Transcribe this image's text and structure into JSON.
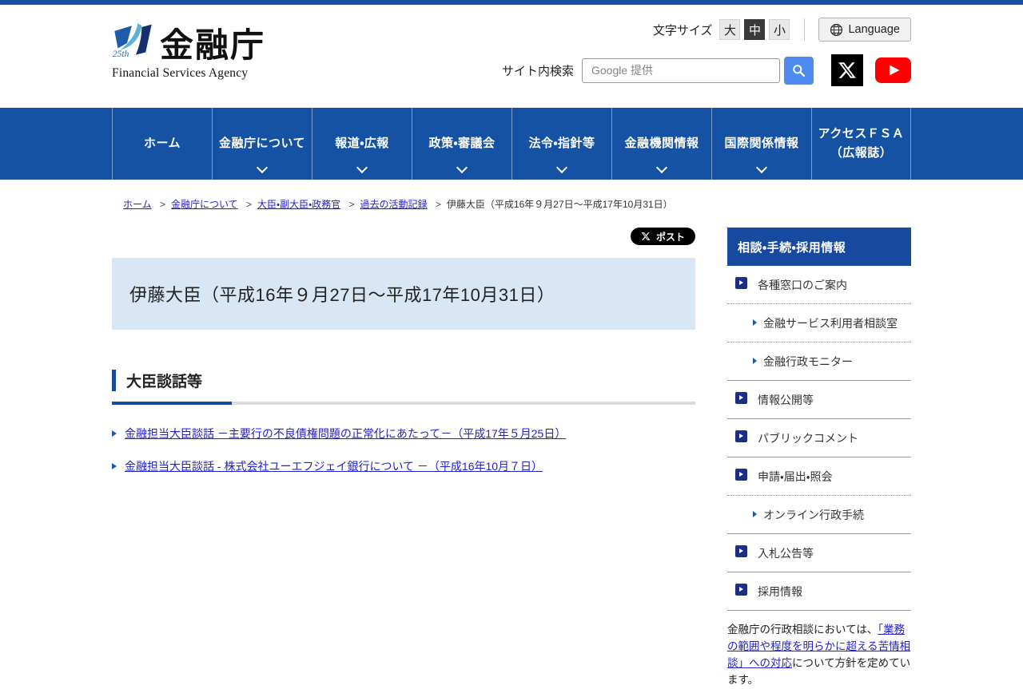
{
  "header": {
    "logo": {
      "title": "金融庁",
      "subtitle": "Financial Services Agency",
      "badge": "25th"
    },
    "font_size": {
      "label": "文字サイズ",
      "options": [
        {
          "label": "大",
          "cls": ""
        },
        {
          "label": "中",
          "cls": "selected"
        },
        {
          "label": "小",
          "cls": ""
        }
      ],
      "selected": "中"
    },
    "language_label": "Language",
    "search": {
      "label": "サイト内検索",
      "placeholder": "Google 提供"
    },
    "icons": [
      "globe-icon",
      "search-icon",
      "x-logo-icon",
      "youtube-icon"
    ]
  },
  "nav": {
    "items": [
      {
        "label": "ホーム",
        "chevron": false
      },
      {
        "label": "金融庁について",
        "chevron": true
      },
      {
        "label": "報道・広報",
        "chevron": true
      },
      {
        "label": "政策・審議会",
        "chevron": true
      },
      {
        "label": "法令・指針等",
        "chevron": true
      },
      {
        "label": "金融機関情報",
        "chevron": true
      },
      {
        "label": "国際関係情報",
        "chevron": true
      },
      {
        "label": "アクセスＦＳＡ\n（広報誌）",
        "chevron": false
      }
    ]
  },
  "breadcrumb": {
    "items": [
      {
        "label": "ホーム",
        "cls": "link",
        "sep": "",
        "interactable": "true"
      },
      {
        "label": "金融庁について",
        "cls": "link",
        "sep": ">",
        "interactable": "true"
      },
      {
        "label": "大臣・副大臣・政務官",
        "cls": "link",
        "sep": ">",
        "interactable": "true"
      },
      {
        "label": "過去の活動記録",
        "cls": "link",
        "sep": ">",
        "interactable": "true"
      },
      {
        "label": "伊藤大臣（平成16年９月27日～平成17年10月31日）",
        "cls": "current",
        "sep": ">",
        "interactable": "false"
      }
    ]
  },
  "post_button": {
    "label": "ポスト"
  },
  "page": {
    "title": "伊藤大臣（平成16年９月27日～平成17年10月31日）",
    "section_title": "大臣談話等",
    "links": [
      {
        "label": "金融担当大臣談話 －主要行の不良債権問題の正常化にあたって－（平成17年５月25日）"
      },
      {
        "label": "金融担当大臣談話 - 株式会社ユーエフジェイ銀行について －（平成16年10月７日）"
      }
    ]
  },
  "sidebar": {
    "title": "相談・手続・採用情報",
    "items": [
      {
        "label": "各種窓口のご案内",
        "cls": "main dotted"
      },
      {
        "label": "金融サービス利用者相談室",
        "cls": "sub dotted"
      },
      {
        "label": "金融行政モニター",
        "cls": "sub solid"
      },
      {
        "label": "情報公開等",
        "cls": "main solid"
      },
      {
        "label": "パブリックコメント",
        "cls": "main solid"
      },
      {
        "label": "申請・届出・照会",
        "cls": "main dotted"
      },
      {
        "label": "オンライン行政手続",
        "cls": "sub solid"
      },
      {
        "label": "入札公告等",
        "cls": "main solid"
      },
      {
        "label": "採用情報",
        "cls": "main solid"
      }
    ],
    "note": {
      "prefix": "金融庁の行政相談においては、",
      "link_text": "「業務の範囲や程度を明らかに超える苦情相談」への対応",
      "suffix": "について方針を定めています。"
    }
  },
  "colors": {
    "brand_blue": "#1552a4",
    "sidebar_header_blue": "#17499e",
    "icon_navy": "#1c2f85",
    "title_box_bg": "#d9e6f4",
    "link_blue": "#2222cc",
    "search_button_blue": "#4d8bf0",
    "youtube_red": "#ff0000",
    "x_black": "#000000"
  }
}
